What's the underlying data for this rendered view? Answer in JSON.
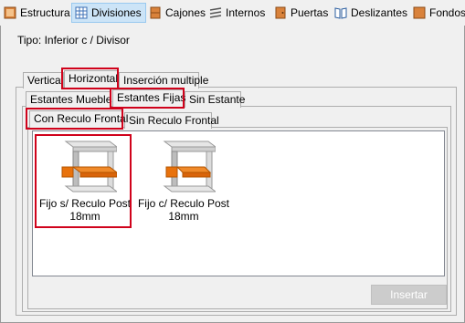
{
  "toolbar": {
    "items": [
      {
        "label": "Estructura",
        "icon": "structure-icon"
      },
      {
        "label": "Divisiones",
        "icon": "grid-icon",
        "selected": true
      },
      {
        "label": "Cajones",
        "icon": "drawer-icon"
      },
      {
        "label": "Internos",
        "icon": "shelves-icon"
      },
      {
        "label": "Puertas",
        "icon": "door-icon"
      },
      {
        "label": "Deslizantes",
        "icon": "sliding-doors-icon"
      },
      {
        "label": "Fondos",
        "icon": "back-panel-icon"
      }
    ]
  },
  "tipo_label": "Tipo: Inferior c / Divisor",
  "tabs_level1": [
    "Vertical",
    "Horizontal",
    "Inserción multiple"
  ],
  "tabs_level2": [
    "Estantes Muebles",
    "Estantes Fijas",
    "Sin Estante"
  ],
  "tabs_level3": [
    "Con Reculo Frontal",
    "Sin Reculo Frontal"
  ],
  "active": {
    "level1": "Horizontal",
    "level2": "Estantes Fijas",
    "level3": "Con Reculo Frontal"
  },
  "items": [
    {
      "caption_line1": "Fijo s/ Reculo Post",
      "caption_line2": "18mm",
      "selected": true
    },
    {
      "caption_line1": "Fijo c/ Reculo Post",
      "caption_line2": "18mm",
      "selected": false
    }
  ],
  "insert_button": "Insertar",
  "colors": {
    "highlight": "#d0021b",
    "shelf": "#e8720c",
    "selection": "#cce4f7"
  }
}
